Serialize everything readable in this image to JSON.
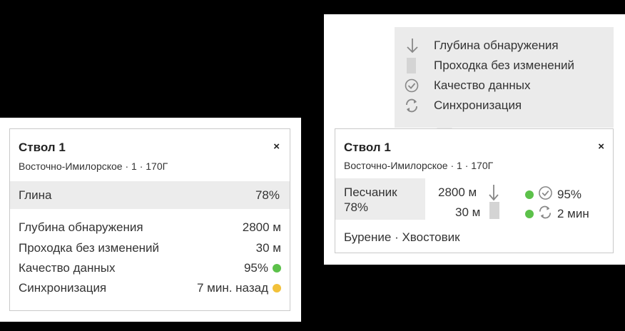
{
  "left_card": {
    "title": "Ствол 1",
    "close_label": "×",
    "subtitle": "Восточно-Имилорское · 1 · 170Г",
    "highlight": {
      "name": "Глина",
      "value": "78%"
    },
    "rows": [
      {
        "label": "Глубина обнаружения",
        "value": "2800 м"
      },
      {
        "label": "Проходка без изменений",
        "value": "30 м"
      },
      {
        "label": "Качество данных",
        "value": "95%",
        "status": "green"
      },
      {
        "label": "Синхронизация",
        "value": "7 мин. назад",
        "status": "yellow"
      }
    ]
  },
  "legend": {
    "items": [
      {
        "icon": "arrow-down-icon",
        "label": "Глубина обнаружения"
      },
      {
        "icon": "gray-bar-icon",
        "label": "Проходка без изменений"
      },
      {
        "icon": "check-circle-icon",
        "label": "Качество данных"
      },
      {
        "icon": "sync-icon",
        "label": "Синхронизация"
      }
    ]
  },
  "right_card": {
    "title": "Ствол 1",
    "close_label": "×",
    "subtitle": "Восточно-Имилорское · 1 · 170Г",
    "rock": {
      "name": "Песчаник",
      "value": "78%"
    },
    "depth": "2800 м",
    "run": "30 м",
    "quality": "95%",
    "sync": "2 мин",
    "footer": "Бурение · Хвостовик"
  },
  "colors": {
    "status_green": "#5cc14a",
    "status_yellow": "#f2c13a",
    "band_gray": "#ececec"
  }
}
